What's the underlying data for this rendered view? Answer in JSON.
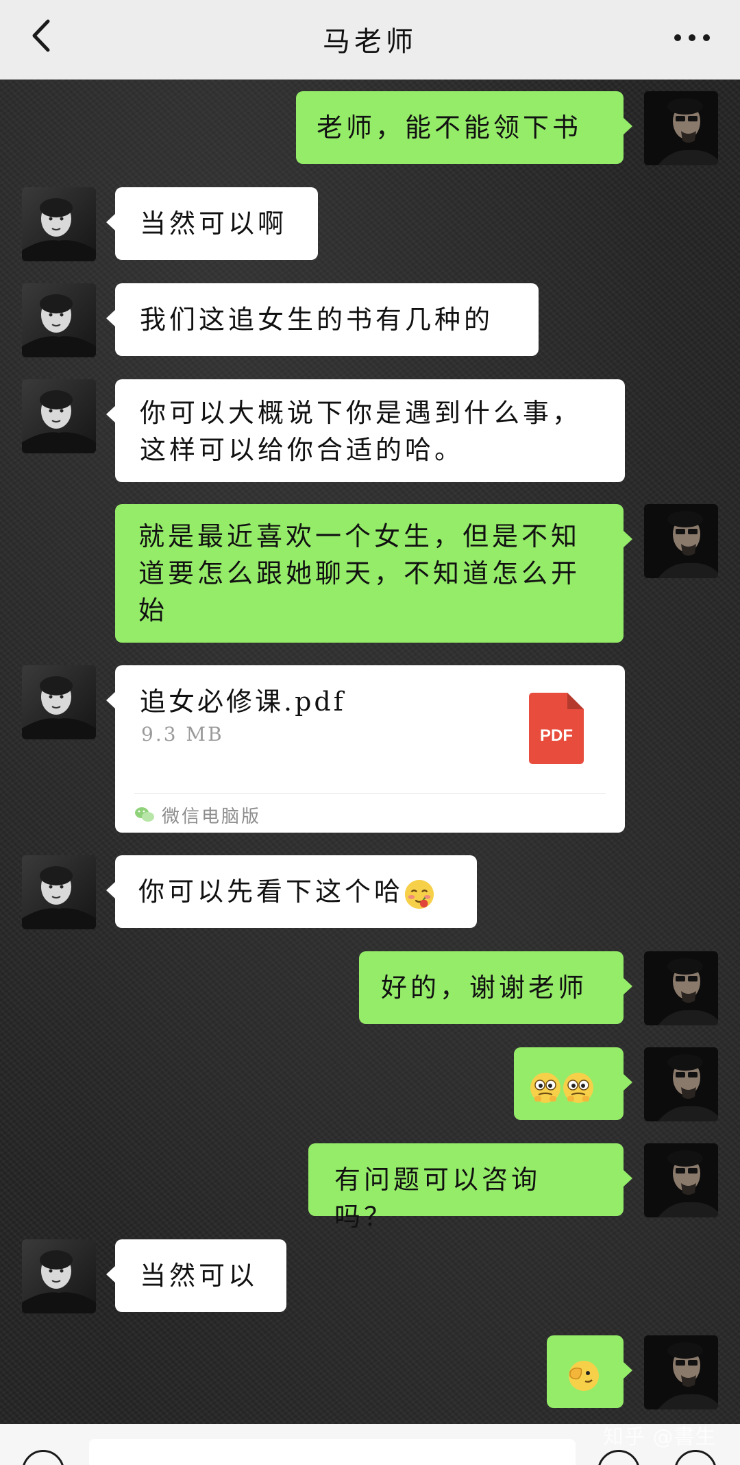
{
  "header": {
    "title": "马老师",
    "back_icon": "chevron-left-icon",
    "more_icon": "more-dots-icon"
  },
  "messages": [
    {
      "side": "right",
      "text": "老师，能不能领下书"
    },
    {
      "side": "left",
      "text": "当然可以啊"
    },
    {
      "side": "left",
      "text": "我们这追女生的书有几种的"
    },
    {
      "side": "left",
      "line1": "你可以大概说下你是遇到什么事，",
      "line2": "这样可以给你合适的哈。"
    },
    {
      "side": "right",
      "line1": "就是最近喜欢一个女生，但是不知",
      "line2": "道要怎么跟她聊天，不知道怎么开",
      "line3": "始"
    },
    {
      "side": "left",
      "type": "file",
      "file_name": "追女必修课.pdf",
      "file_size": "9.3 MB",
      "file_type": "PDF",
      "source": "微信电脑版"
    },
    {
      "side": "left",
      "text": "你可以先看下这个哈",
      "emoji": "shy-emoji"
    },
    {
      "side": "right",
      "text": "好的，谢谢老师"
    },
    {
      "side": "right",
      "emoji": "eyes-emoji-pair"
    },
    {
      "side": "right",
      "text": "有问题可以咨询吗？"
    },
    {
      "side": "left",
      "text": "当然可以"
    },
    {
      "side": "right",
      "emoji": "peek-emoji"
    }
  ],
  "watermark": "知乎 @書生",
  "colors": {
    "header_bg": "#ededed",
    "green_bubble": "#95ec69",
    "white_bubble": "#ffffff",
    "pdf_red": "#e74c3c"
  }
}
